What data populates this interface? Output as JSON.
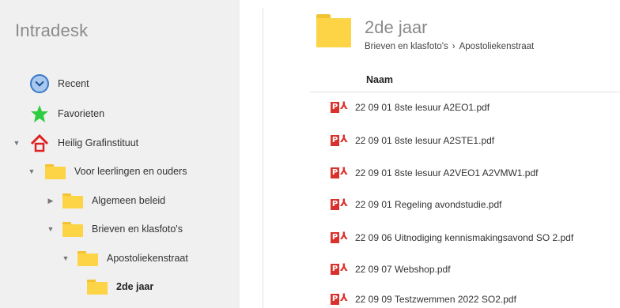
{
  "app": {
    "title": "Intradesk"
  },
  "sidebar": {
    "recent_label": "Recent",
    "favorites_label": "Favorieten",
    "tree": [
      {
        "label": "Heilig Grafinstituut"
      },
      {
        "label": "Voor leerlingen en ouders"
      },
      {
        "label": "Algemeen beleid"
      },
      {
        "label": "Brieven en klasfoto's"
      },
      {
        "label": "Apostoliekenstraat"
      },
      {
        "label": "2de jaar"
      }
    ]
  },
  "main": {
    "title": "2de jaar",
    "breadcrumb": [
      "Brieven en klasfoto's",
      "›",
      "Apostoliekenstraat"
    ],
    "column_header": "Naam",
    "files": [
      "22 09 01 8ste lesuur A2EO1.pdf",
      "22 09 01 8ste lesuur A2STE1.pdf",
      "22 09 01 8ste lesuur A2VEO1 A2VMW1.pdf",
      "22 09 01 Regeling avondstudie.pdf",
      "22 09 06 Uitnodiging kennismakingsavond SO 2.pdf",
      "22 09 07 Webshop.pdf",
      "22 09 09 Testzwemmen 2022 SO2.pdf"
    ]
  },
  "colors": {
    "folder": "#fcd446",
    "pdf": "#d9312b",
    "sidebar_bg": "#f0f0f0",
    "home_icon": "#e02020",
    "star": "#2ecc40"
  }
}
